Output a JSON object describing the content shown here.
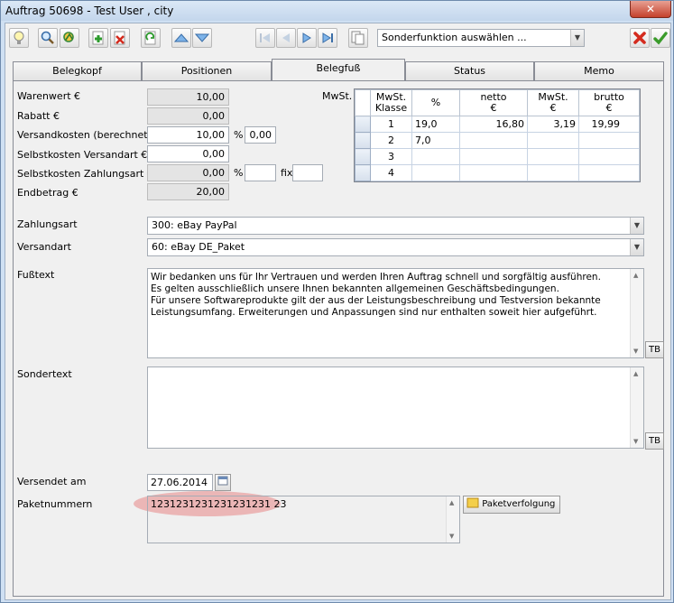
{
  "window": {
    "title": "Auftrag 50698 - Test User , city",
    "close_label": "✕"
  },
  "toolbar": {
    "special_function": {
      "value": "Sonderfunktion auswählen ..."
    },
    "icons": [
      "lightbulb-icon",
      "search-icon",
      "refresh-search-icon",
      "add-icon",
      "delete-icon",
      "copy-icon",
      "arrow-up-icon",
      "arrow-down-icon",
      "first-icon",
      "previous-icon",
      "next-icon",
      "last-icon",
      "document-icon",
      "cancel-icon",
      "confirm-icon"
    ]
  },
  "tabs": [
    {
      "label": "Belegkopf"
    },
    {
      "label": "Positionen"
    },
    {
      "label": "Belegfuß",
      "active": true
    },
    {
      "label": "Status"
    },
    {
      "label": "Memo"
    }
  ],
  "totals": {
    "warenwert": {
      "label": "Warenwert €",
      "value": "10,00"
    },
    "rabatt": {
      "label": "Rabatt €",
      "value": "0,00"
    },
    "versandkosten": {
      "label": "Versandkosten (berechnet) €",
      "value": "10,00",
      "pct_symbol": "%",
      "pct_value": "0,00"
    },
    "selbstkosten_versandart": {
      "label": "Selbstkosten Versandart €",
      "value": "0,00"
    },
    "selbstkosten_zahlungsart": {
      "label": "Selbstkosten Zahlungsart €",
      "value": "0,00",
      "pct_symbol": "%",
      "pct_value": "",
      "fix_label": "fix",
      "fix_value": ""
    },
    "endbetrag": {
      "label": "Endbetrag €",
      "value": "20,00"
    }
  },
  "mwst": {
    "label": "MwSt.",
    "headers": [
      [
        "MwSt.",
        "Klasse"
      ],
      [
        "%",
        ""
      ],
      [
        "netto",
        "€"
      ],
      [
        "MwSt.",
        "€"
      ],
      [
        "brutto",
        "€"
      ]
    ],
    "rows": [
      [
        "1",
        "19,0",
        "16,80",
        "3,19",
        "19,99"
      ],
      [
        "2",
        "7,0",
        "",
        "",
        ""
      ],
      [
        "3",
        "",
        "",
        "",
        ""
      ],
      [
        "4",
        "",
        "",
        "",
        ""
      ]
    ]
  },
  "zahlungsart": {
    "label": "Zahlungsart",
    "value": "300: eBay PayPal"
  },
  "versandart": {
    "label": "Versandart",
    "value": "60: eBay DE_Paket"
  },
  "fusstext": {
    "label": "Fußtext",
    "lines": [
      "Wir bedanken uns für Ihr Vertrauen und werden Ihren Auftrag schnell und sorgfältig ausführen.",
      "Es gelten ausschließlich unsere Ihnen bekannten allgemeinen Geschäftsbedingungen.",
      "Für unsere Softwareprodukte gilt der aus der Leistungsbeschreibung und Testversion bekannte",
      "Leistungsumfang. Erweiterungen und Anpassungen sind nur enthalten soweit hier aufgeführt."
    ],
    "tb_label": "TB"
  },
  "sondertext": {
    "label": "Sondertext",
    "value": "",
    "tb_label": "TB"
  },
  "versendet_am": {
    "label": "Versendet am",
    "value": "27.06.2014"
  },
  "paketnummern": {
    "label": "Paketnummern",
    "value": "1231231231231231231 23",
    "tracking_label": "Paketverfolgung"
  }
}
